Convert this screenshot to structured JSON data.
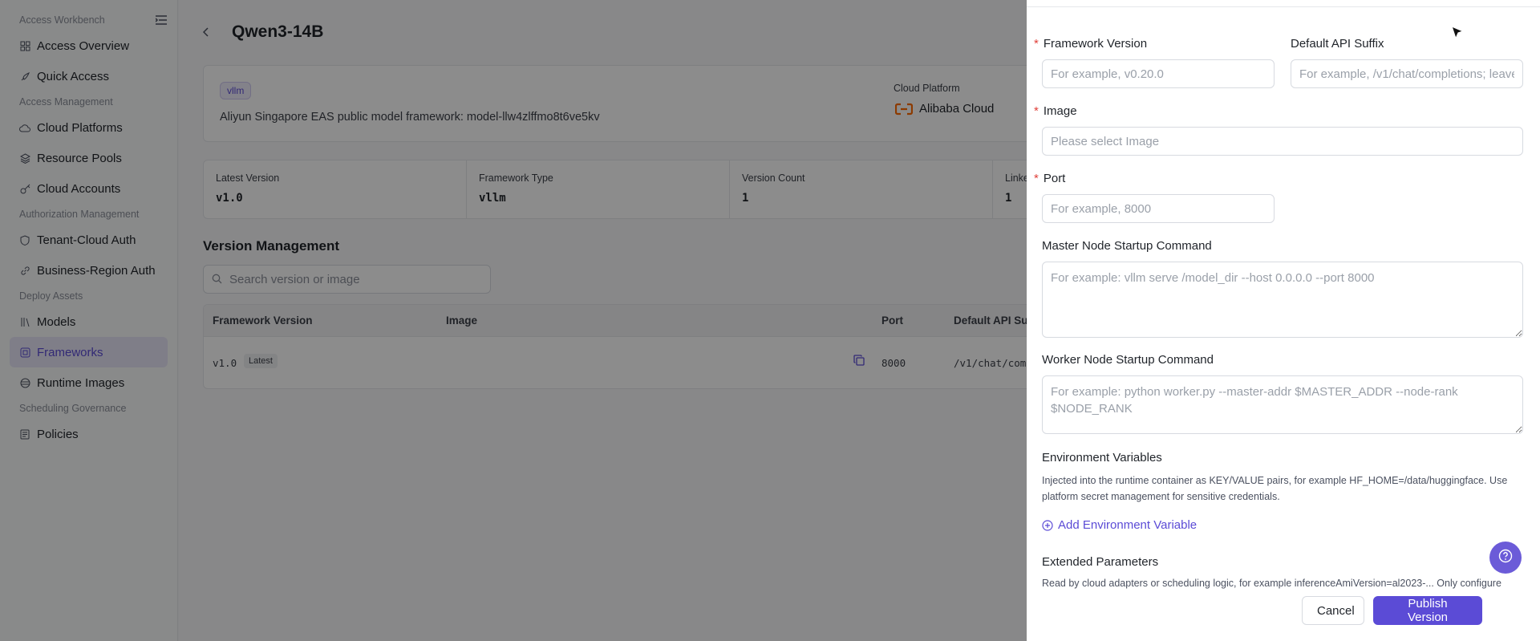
{
  "sidebar": {
    "workbench_title": "Access Workbench",
    "groups": [
      {
        "label": ""
      },
      {
        "label": "Access Management"
      },
      {
        "label": "Authorization Management"
      },
      {
        "label": "Deploy Assets"
      },
      {
        "label": "Scheduling Governance"
      }
    ],
    "items": [
      {
        "label": "Access Overview",
        "icon": "grid-icon"
      },
      {
        "label": "Quick Access",
        "icon": "rocket-icon"
      },
      {
        "label": "Cloud Platforms",
        "icon": "cloud-icon"
      },
      {
        "label": "Resource Pools",
        "icon": "layers-icon"
      },
      {
        "label": "Cloud Accounts",
        "icon": "key-icon"
      },
      {
        "label": "Tenant-Cloud Auth",
        "icon": "shield-icon"
      },
      {
        "label": "Business-Region Auth",
        "icon": "link-icon"
      },
      {
        "label": "Models",
        "icon": "library-icon"
      },
      {
        "label": "Frameworks",
        "icon": "framework-icon"
      },
      {
        "label": "Runtime Images",
        "icon": "package-icon"
      },
      {
        "label": "Policies",
        "icon": "policy-icon"
      }
    ]
  },
  "header": {
    "title": "Qwen3-14B"
  },
  "info_card": {
    "tag": "vllm",
    "description": "Aliyun Singapore EAS public model framework: model-llw4zlffmo8t6ve5kv",
    "cloud_platform_label": "Cloud Platform",
    "cloud_platform_value": "Alibaba Cloud"
  },
  "stats": [
    {
      "label": "Latest Version",
      "value": "v1.0"
    },
    {
      "label": "Framework Type",
      "value": "vllm"
    },
    {
      "label": "Version Count",
      "value": "1"
    },
    {
      "label": "Linke",
      "value": "1"
    }
  ],
  "version_management": {
    "title": "Version Management",
    "search_placeholder": "Search version or image",
    "columns": [
      "Framework Version",
      "Image",
      "Port",
      "Default API Su"
    ],
    "rows": [
      {
        "version": "v1.0",
        "badge": "Latest",
        "image": "",
        "port": "8000",
        "api_suffix": "/v1/chat/com"
      }
    ]
  },
  "drawer": {
    "framework_version_label": "Framework Version",
    "framework_version_placeholder": "For example, v0.20.0",
    "default_api_suffix_label": "Default API Suffix",
    "default_api_suffix_placeholder": "For example, /v1/chat/completions; leave",
    "image_label": "Image",
    "image_placeholder": "Please select Image",
    "port_label": "Port",
    "port_placeholder": "For example, 8000",
    "master_cmd_label": "Master Node Startup Command",
    "master_cmd_placeholder": "For example: vllm serve /model_dir --host 0.0.0.0 --port 8000",
    "worker_cmd_label": "Worker Node Startup Command",
    "worker_cmd_placeholder": "For example: python worker.py --master-addr $MASTER_ADDR --node-rank $NODE_RANK",
    "env_vars_label": "Environment Variables",
    "env_vars_help": "Injected into the runtime container as KEY/VALUE pairs, for example HF_HOME=/data/huggingface. Use platform secret management for sensitive credentials.",
    "add_env_var_label": "Add Environment Variable",
    "extended_params_label": "Extended Parameters",
    "extended_params_help": "Read by cloud adapters or scheduling logic, for example inferenceAmiVersion=al2023-... Only configure",
    "cancel_label": "Cancel",
    "publish_label": "Publish Version"
  },
  "colors": {
    "accent": "#5b4bd6",
    "required": "#e0413a",
    "cloud_logo": "#ff6a00"
  }
}
